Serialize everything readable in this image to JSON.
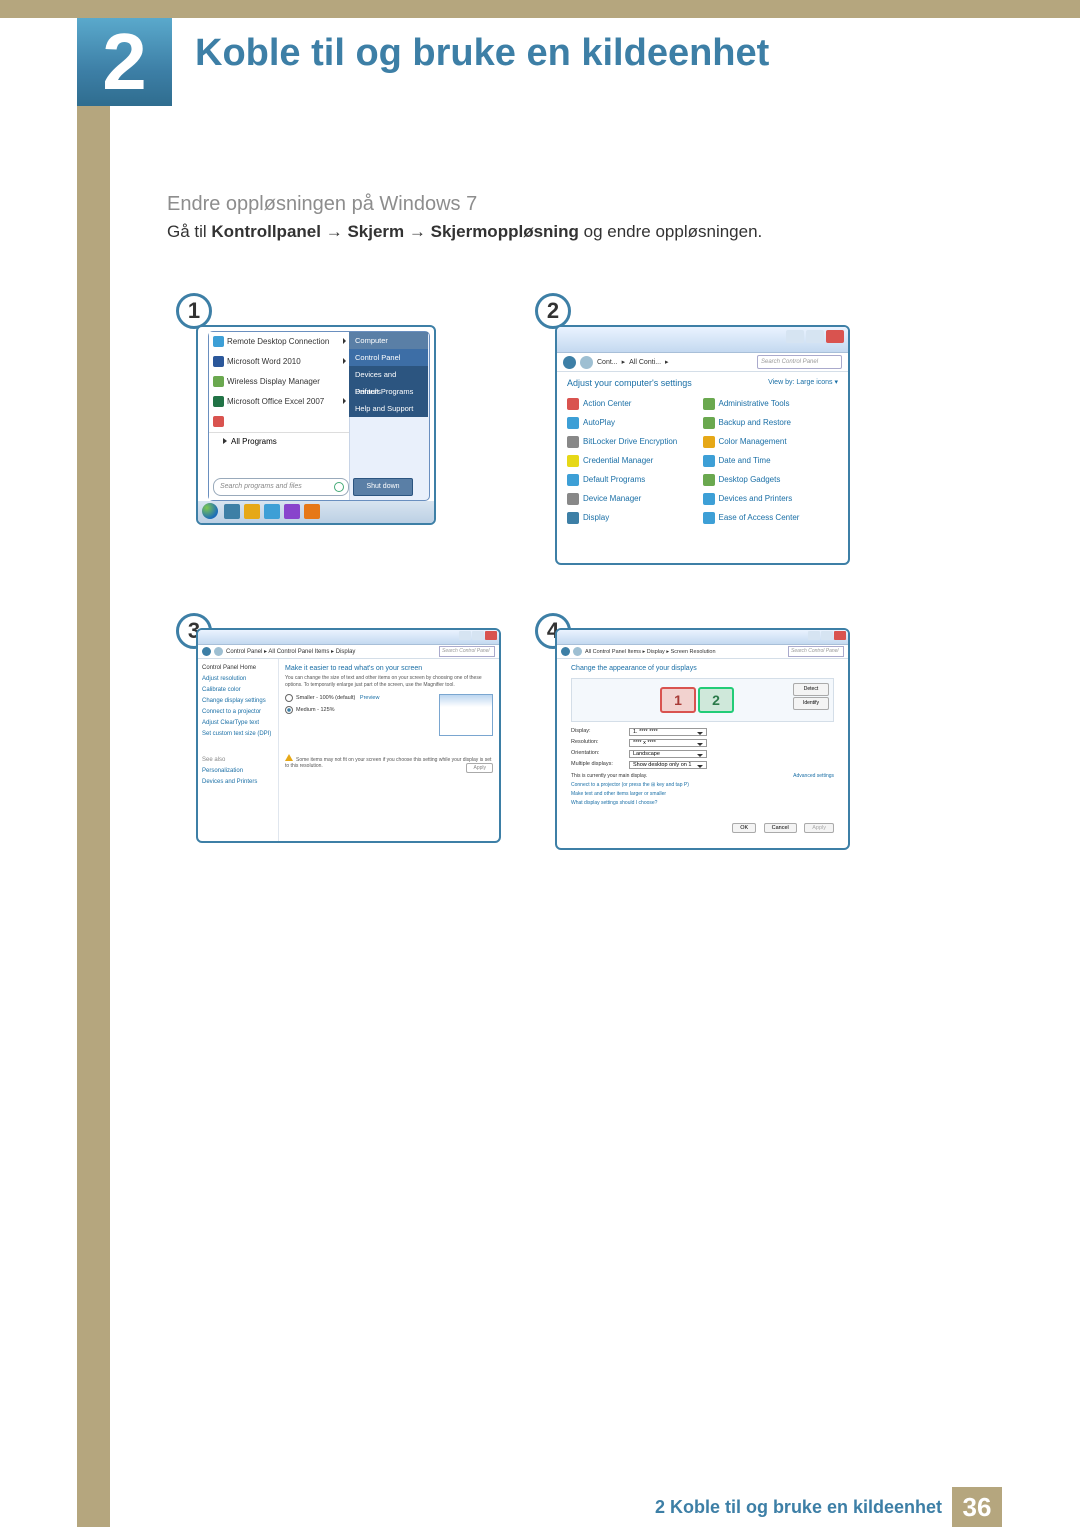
{
  "chapter": {
    "number": "2",
    "title": "Koble til og bruke en kildeenhet"
  },
  "section": {
    "subtitle": "Endre oppløsningen på Windows 7",
    "instruction_pre": "Gå til ",
    "instruction_b1": "Kontrollpanel",
    "instruction_arr": " → ",
    "instruction_b2": "Skjerm",
    "instruction_b3": "Skjermoppløsning",
    "instruction_post": " og endre oppløsningen."
  },
  "badges": {
    "b1": "1",
    "b2": "2",
    "b3": "3",
    "b4": "4"
  },
  "panel1": {
    "items": [
      "Remote Desktop Connection",
      "Microsoft Word 2010",
      "Wireless Display Manager",
      "Microsoft Office Excel 2007",
      ""
    ],
    "all_programs": "All Programs",
    "search_placeholder": "Search programs and files",
    "right_items": [
      "Computer",
      "Control Panel",
      "Devices and Printers",
      "Default Programs",
      "Help and Support"
    ],
    "shutdown": "Shut down"
  },
  "panel2": {
    "breadcrumb": [
      "Cont...",
      "All Conti..."
    ],
    "search_placeholder": "Search Control Panel",
    "heading": "Adjust your computer's settings",
    "viewby": "View by:  Large icons ▾",
    "items_left": [
      "Action Center",
      "AutoPlay",
      "BitLocker Drive Encryption",
      "Credential Manager",
      "Default Programs",
      "Device Manager",
      "Display"
    ],
    "items_right": [
      "Administrative Tools",
      "Backup and Restore",
      "Color Management",
      "Date and Time",
      "Desktop Gadgets",
      "Devices and Printers",
      "Ease of Access Center"
    ]
  },
  "panel3": {
    "breadcrumb": "Control Panel  ▸  All Control Panel Items  ▸  Display",
    "search_placeholder": "Search Control Panel",
    "side_header": "Control Panel Home",
    "side_links": [
      "Adjust resolution",
      "Calibrate color",
      "Change display settings",
      "Connect to a projector",
      "Adjust ClearType text",
      "Set custom text size (DPI)"
    ],
    "side_seealso": "See also",
    "side_seealso_links": [
      "Personalization",
      "Devices and Printers"
    ],
    "main_heading": "Make it easier to read what's on your screen",
    "main_desc": "You can change the size of text and other items on your screen by choosing one of these options. To temporarily enlarge just part of the screen, use the Magnifier tool.",
    "opt1": "Smaller - 100% (default)",
    "opt1_tag": "Preview",
    "opt2": "Medium - 125%",
    "warn_text": "Some items may not fit on your screen if you choose this setting while your display is set to this resolution.",
    "apply": "Apply"
  },
  "panel4": {
    "breadcrumb": "All Control Panel Items  ▸  Display  ▸  Screen Resolution",
    "search_placeholder": "Search Control Panel",
    "heading": "Change the appearance of your displays",
    "detect": "Detect",
    "identify": "Identify",
    "mon1": "1",
    "mon2": "2",
    "fields": {
      "display_lbl": "Display:",
      "display_val": "1. **** ****",
      "resolution_lbl": "Resolution:",
      "resolution_val": "**** x ****",
      "orientation_lbl": "Orientation:",
      "orientation_val": "Landscape",
      "multi_lbl": "Multiple displays:",
      "multi_val": "Show desktop only on 1"
    },
    "note": "This is currently your main display.",
    "advanced": "Advanced settings",
    "link1": "Connect to a projector (or press the ⊞ key and tap P)",
    "link2": "Make text and other items larger or smaller",
    "link3": "What display settings should I choose?",
    "buttons": {
      "ok": "OK",
      "cancel": "Cancel",
      "apply": "Apply"
    }
  },
  "footer": {
    "text": "2 Koble til og bruke en kildeenhet",
    "page": "36"
  }
}
